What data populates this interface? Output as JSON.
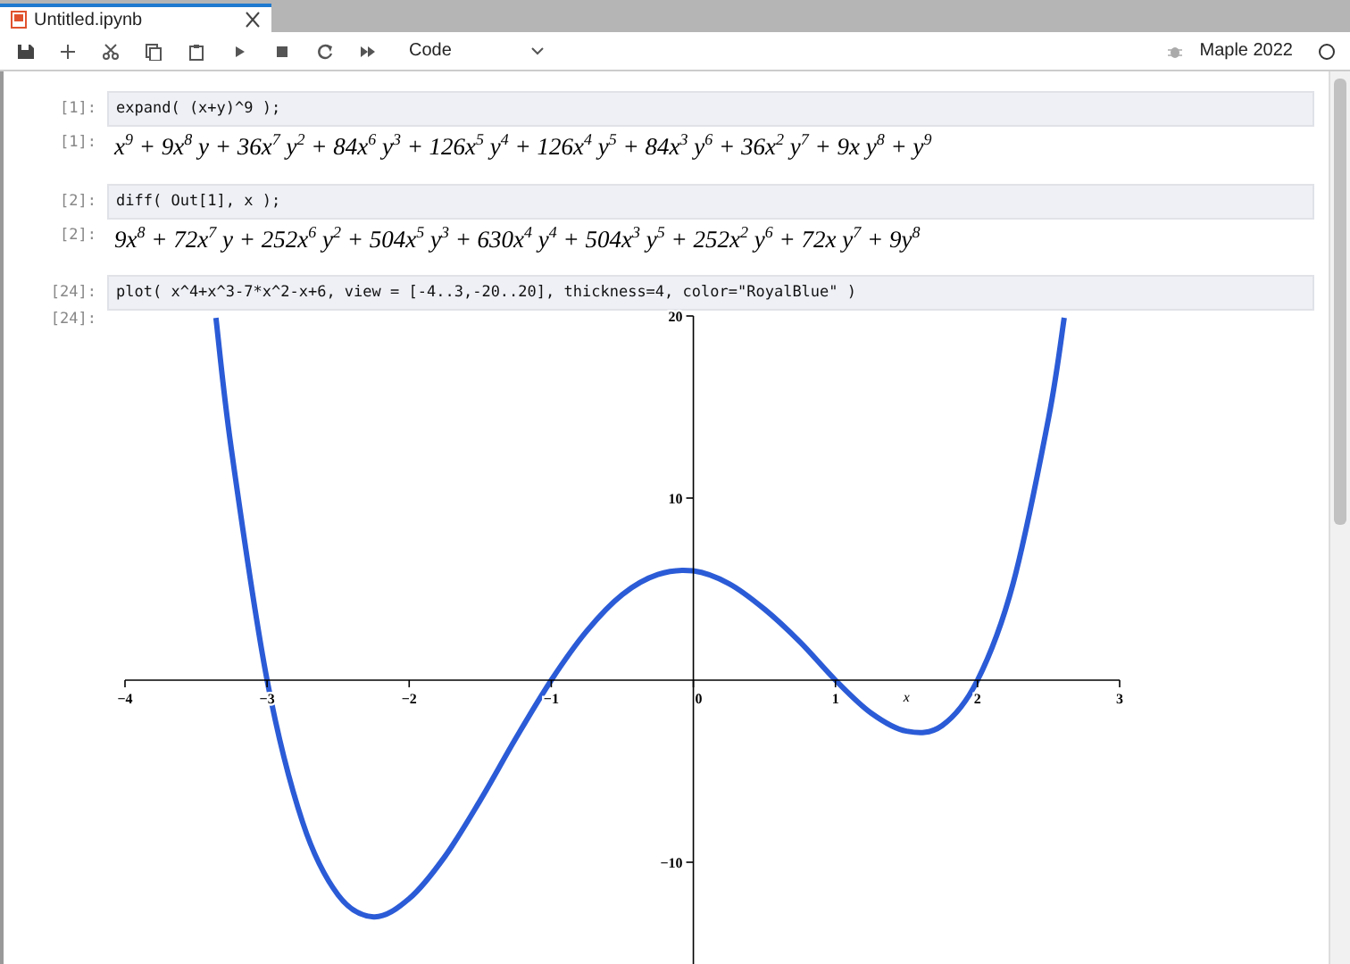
{
  "tab": {
    "title": "Untitled.ipynb",
    "selected": true
  },
  "toolbar": {
    "cell_type": "Code",
    "kernel": "Maple 2022"
  },
  "cells": [
    {
      "kind": "input",
      "prompt": "[1]:",
      "code": "expand( (x+y)^9 );"
    },
    {
      "kind": "math",
      "prompt": "[1]:",
      "math": "x$^{9}$ + 9x$^{8}$ y + 36x$^{7}$ y$^{2}$ + 84x$^{6}$ y$^{3}$ + 126x$^{5}$ y$^{4}$ + 126x$^{4}$ y$^{5}$ + 84x$^{3}$ y$^{6}$ + 36x$^{2}$ y$^{7}$ + 9x y$^{8}$ + y$^{9}$"
    },
    {
      "kind": "input",
      "prompt": "[2]:",
      "code": "diff( Out[1], x );"
    },
    {
      "kind": "math",
      "prompt": "[2]:",
      "math": "9x$^{8}$ + 72x$^{7}$ y + 252x$^{6}$ y$^{2}$ + 504x$^{5}$ y$^{3}$ + 630x$^{4}$ y$^{4}$ + 504x$^{3}$ y$^{5}$ + 252x$^{2}$ y$^{6}$ + 72x y$^{7}$ + 9y$^{8}$"
    },
    {
      "kind": "input",
      "prompt": "[24]:",
      "code": "plot( x^4+x^3-7*x^2-x+6, view = [-4..3,-20..20], thickness=4, color=\"RoyalBlue\" )"
    },
    {
      "kind": "plot",
      "prompt": "[24]:",
      "chart_data": {
        "type": "line",
        "xlabel": "x",
        "x": [
          -3.36,
          -3.25,
          -3,
          -2.75,
          -2.5,
          -2.25,
          -2,
          -1.75,
          -1.5,
          -1.25,
          -1,
          -0.75,
          -0.5,
          -0.25,
          0,
          0.25,
          0.5,
          0.75,
          1,
          1.25,
          1.5,
          1.75,
          2,
          2.25,
          2.5,
          2.61
        ],
        "series": [
          {
            "color": "#2b5bd6",
            "values": [
              19.9,
              12.6,
              0,
              -7.8,
              -11.8,
              -13,
              -12,
              -9.7,
              -6.6,
              -3.2,
              0,
              2.7,
              4.7,
              5.8,
              6,
              5.3,
              3.9,
              2.1,
              0,
              -1.8,
              -2.8,
              -2.5,
              0,
              5.3,
              14.4,
              19.9
            ]
          }
        ],
        "xlim": [
          -4,
          3
        ],
        "ylim": [
          -20,
          20
        ],
        "xticks": [
          -4,
          -3,
          -2,
          -1,
          0,
          1,
          2,
          3
        ],
        "yticks": [
          -10,
          10,
          20
        ]
      }
    }
  ]
}
